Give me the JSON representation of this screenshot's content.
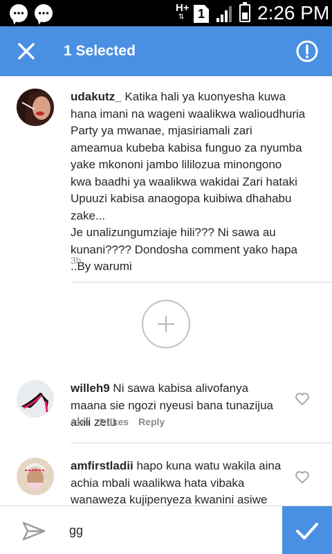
{
  "status_bar": {
    "time": "2:26 PM",
    "network": "H+",
    "network_arrows": "⇅",
    "sim": "1",
    "icons": [
      "chat-bubble-icon",
      "chat-bubble-icon",
      "signal-icon",
      "battery-charging-icon"
    ]
  },
  "app_bar": {
    "title": "1 Selected",
    "close_icon": "close-icon",
    "report_icon": "alert-circle-icon",
    "color": "#4a90e2"
  },
  "caption": {
    "username": "udakutz_",
    "text": "Katika hali ya kuonyesha kuwa hana imani na wageni waalikwa walioudhuria Party ya mwanae, mjasiriamali zari ameamua kubeba kabisa funguo za nyumba yake mkononi jambo lililozua minongono kwa baadhi ya waalikwa wakidai Zari hataki Upuuzi kabisa anaogopa kuibiwa dhahabu zake...",
    "text2": "Je unalizungumziaje hili??? Ni sawa au kunani???? Dondosha comment yako hapa ..By warumi",
    "time": "3h"
  },
  "add_button_icon": "plus-icon",
  "comments": [
    {
      "username": "willeh9",
      "text": "Ni sawa kabisa alivofanya maana sie ngozi nyeusi bana tunazijua akili zetu",
      "time": "41m",
      "likes": "2 likes",
      "reply": "Reply"
    },
    {
      "username": "amfirstladii",
      "text": "hapo kuna watu wakila aina achia mbali waalikwa hata vibaka wanaweza kujipenyeza kwanini asiwe",
      "time": "",
      "likes": "",
      "reply": ""
    }
  ],
  "composer": {
    "value": "gg",
    "send_icon": "send-icon",
    "confirm_icon": "checkmark-icon"
  }
}
